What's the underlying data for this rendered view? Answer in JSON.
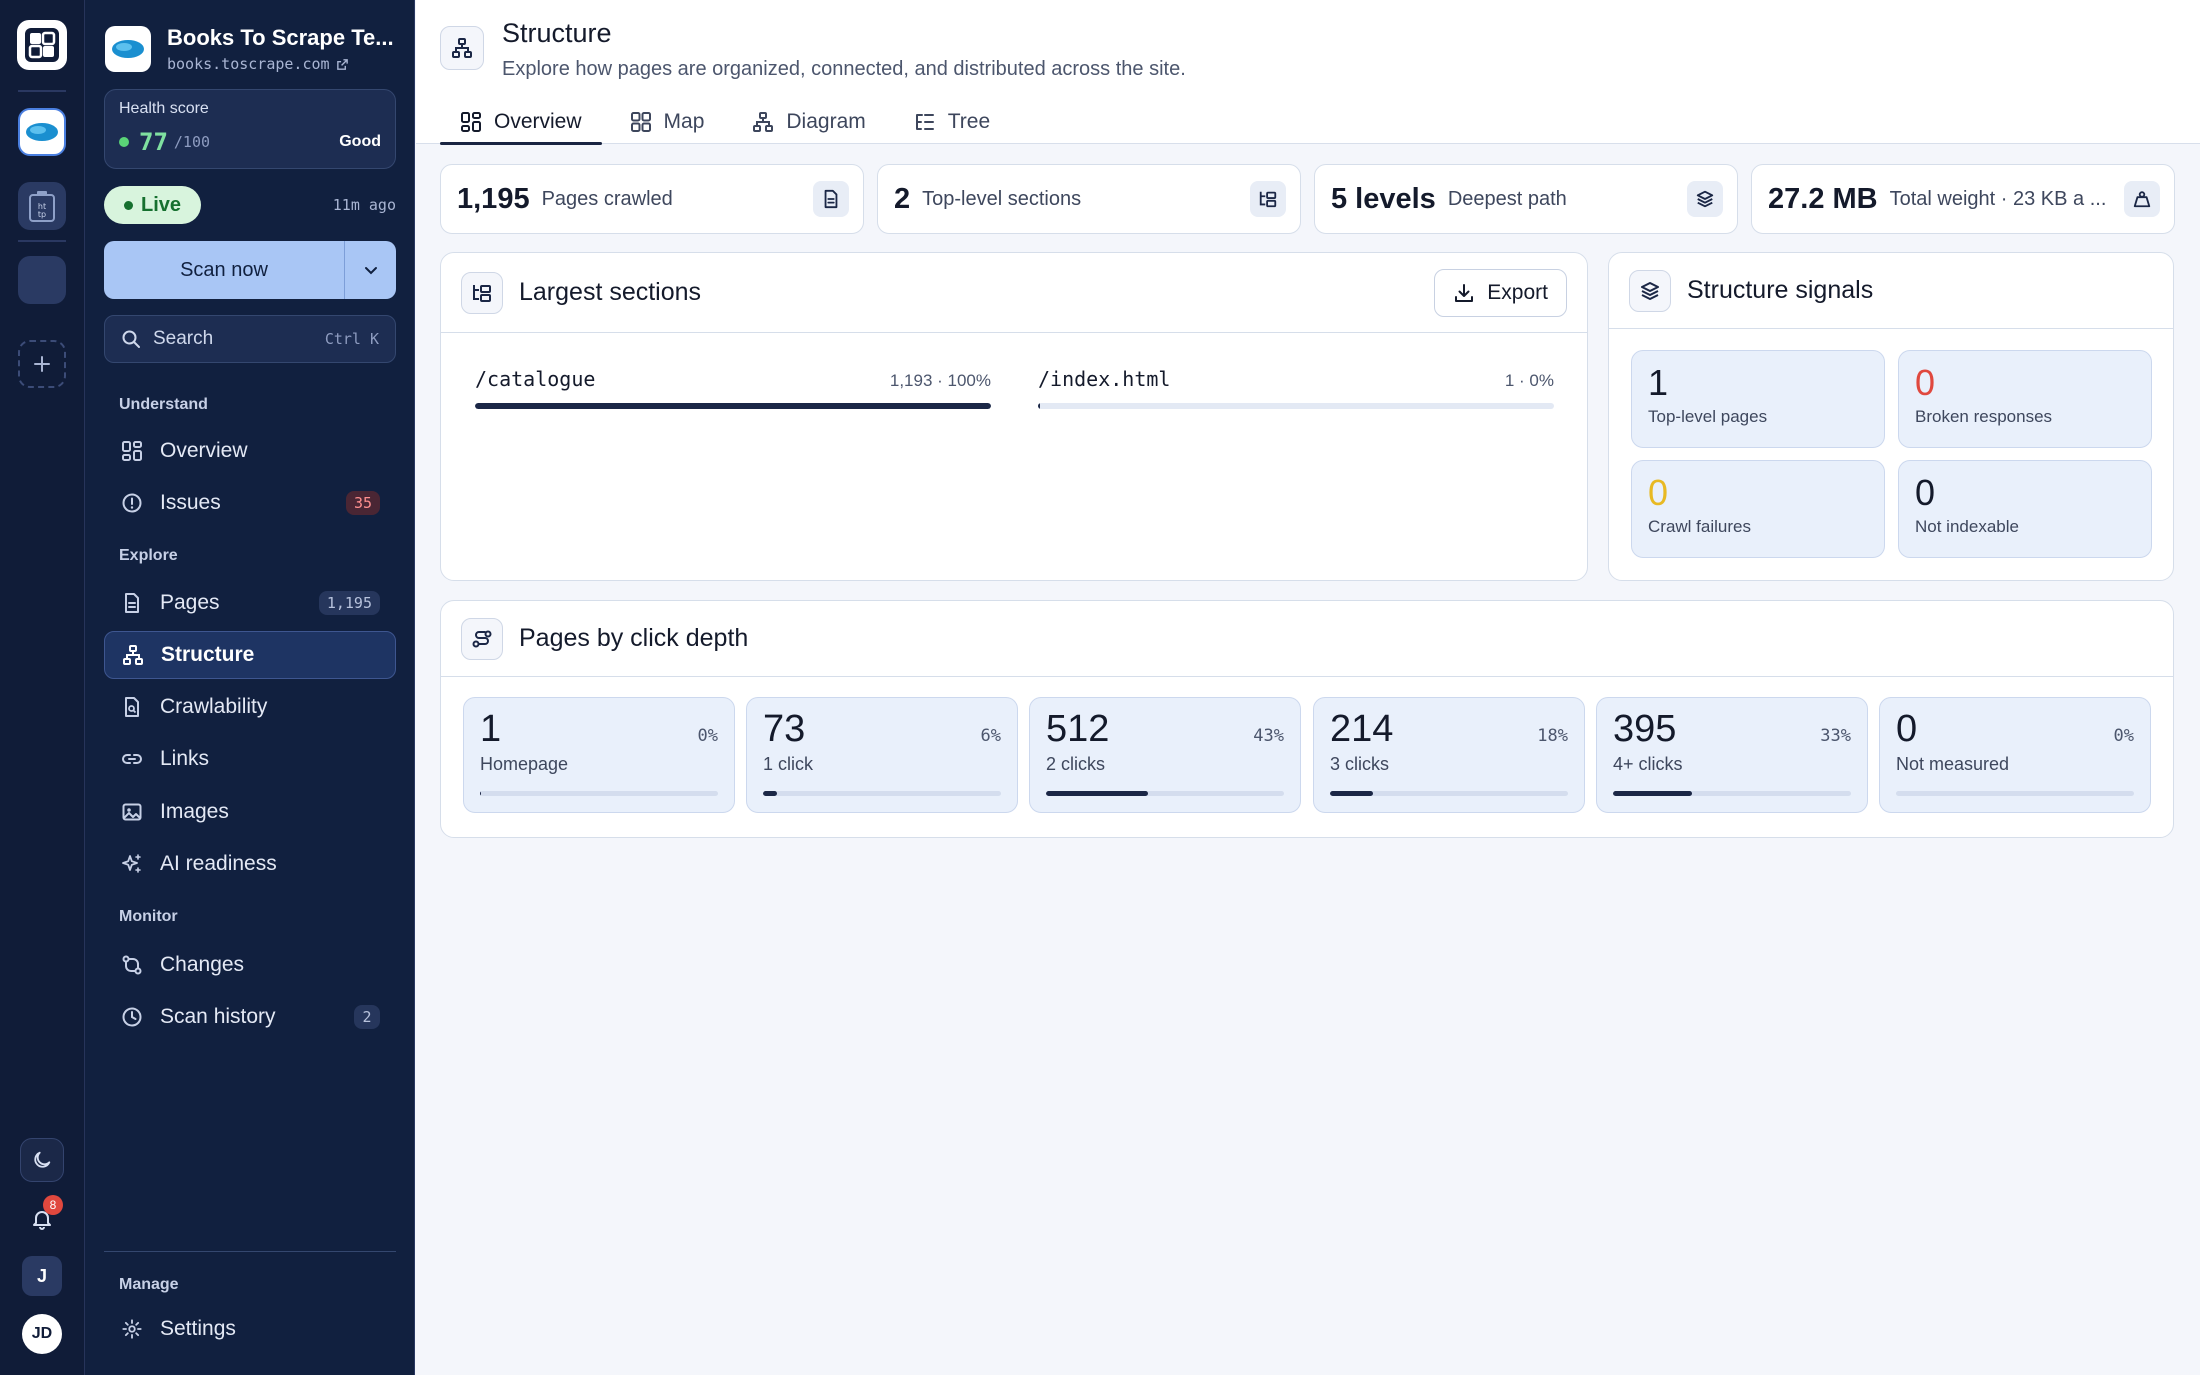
{
  "site": {
    "title": "Books To Scrape Te...",
    "url": "books.toscrape.com"
  },
  "health": {
    "label": "Health score",
    "score": "77",
    "max": "/100",
    "status": "Good"
  },
  "live": {
    "label": "Live",
    "ago": "11m ago"
  },
  "scan": {
    "label": "Scan now"
  },
  "search": {
    "placeholder": "Search",
    "shortcut": "Ctrl K"
  },
  "nav": {
    "understand": "Understand",
    "explore": "Explore",
    "monitor": "Monitor",
    "manage": "Manage",
    "overview": "Overview",
    "issues": "Issues",
    "issues_count": "35",
    "pages": "Pages",
    "pages_count": "1,195",
    "structure": "Structure",
    "crawlability": "Crawlability",
    "links": "Links",
    "images": "Images",
    "ai_readiness": "AI readiness",
    "changes": "Changes",
    "scan_history": "Scan history",
    "scan_history_count": "2",
    "settings": "Settings"
  },
  "rail": {
    "notifications": "8",
    "user_initial": "J",
    "avatar": "JD"
  },
  "header": {
    "title": "Structure",
    "subtitle": "Explore how pages are organized, connected, and distributed across the site.",
    "tabs": [
      "Overview",
      "Map",
      "Diagram",
      "Tree"
    ]
  },
  "stats": [
    {
      "value": "1,195",
      "label": "Pages crawled"
    },
    {
      "value": "2",
      "label": "Top-level sections"
    },
    {
      "value": "5 levels",
      "label": "Deepest path"
    },
    {
      "value": "27.2 MB",
      "label": "Total weight · 23 KB a ..."
    }
  ],
  "largest_sections": {
    "title": "Largest sections",
    "export_label": "Export",
    "items": [
      {
        "path": "/catalogue",
        "meta": "1,193 · 100%",
        "share": 100
      },
      {
        "path": "/index.html",
        "meta": "1 · 0%",
        "share": 0.3
      }
    ]
  },
  "signals": {
    "title": "Structure signals",
    "items": [
      {
        "value": "1",
        "label": "Top-level pages",
        "color": "#141a2b"
      },
      {
        "value": "0",
        "label": "Broken responses",
        "color": "#e0483e"
      },
      {
        "value": "0",
        "label": "Crawl failures",
        "color": "#e8b923"
      },
      {
        "value": "0",
        "label": "Not indexable",
        "color": "#141a2b"
      }
    ]
  },
  "depth": {
    "title": "Pages by click depth",
    "items": [
      {
        "value": "1",
        "pct": "0%",
        "label": "Homepage",
        "share": 0.5
      },
      {
        "value": "73",
        "pct": "6%",
        "label": "1 click",
        "share": 6
      },
      {
        "value": "512",
        "pct": "43%",
        "label": "2 clicks",
        "share": 43
      },
      {
        "value": "214",
        "pct": "18%",
        "label": "3 clicks",
        "share": 18
      },
      {
        "value": "395",
        "pct": "33%",
        "label": "4+ clicks",
        "share": 33
      },
      {
        "value": "0",
        "pct": "0%",
        "label": "Not measured",
        "share": 0
      }
    ]
  }
}
